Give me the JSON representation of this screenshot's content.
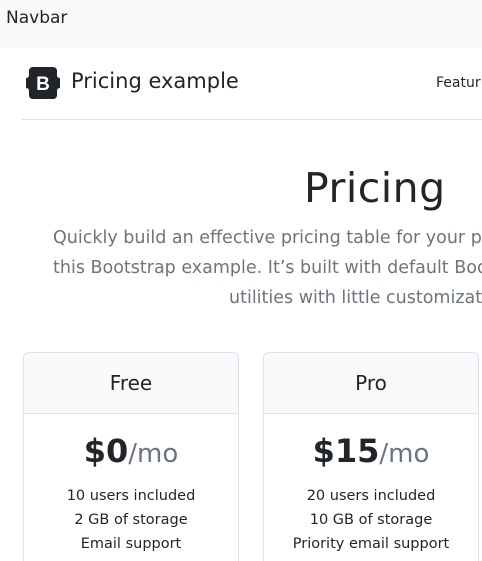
{
  "topbar": {
    "brand": "Navbar"
  },
  "header": {
    "logo_letter": "B",
    "title": "Pricing example",
    "nav_link": "Featur"
  },
  "hero": {
    "title": "Pricing",
    "lines": [
      "Quickly build an effective pricing table for your p",
      "this Bootstrap example. It’s built with default Boo",
      "utilities with little customizati"
    ]
  },
  "plans": [
    {
      "name": "Free",
      "amount": "$0",
      "unit": "/mo",
      "features": [
        "10 users included",
        "2 GB of storage",
        "Email support"
      ]
    },
    {
      "name": "Pro",
      "amount": "$15",
      "unit": "/mo",
      "features": [
        "20 users included",
        "10 GB of storage",
        "Priority email support"
      ]
    }
  ],
  "colors": {
    "topbar_bg": "#f8f9fa",
    "text": "#212529",
    "muted": "#6c757d",
    "border": "#dee2e6",
    "logo_bg": "#212529"
  }
}
